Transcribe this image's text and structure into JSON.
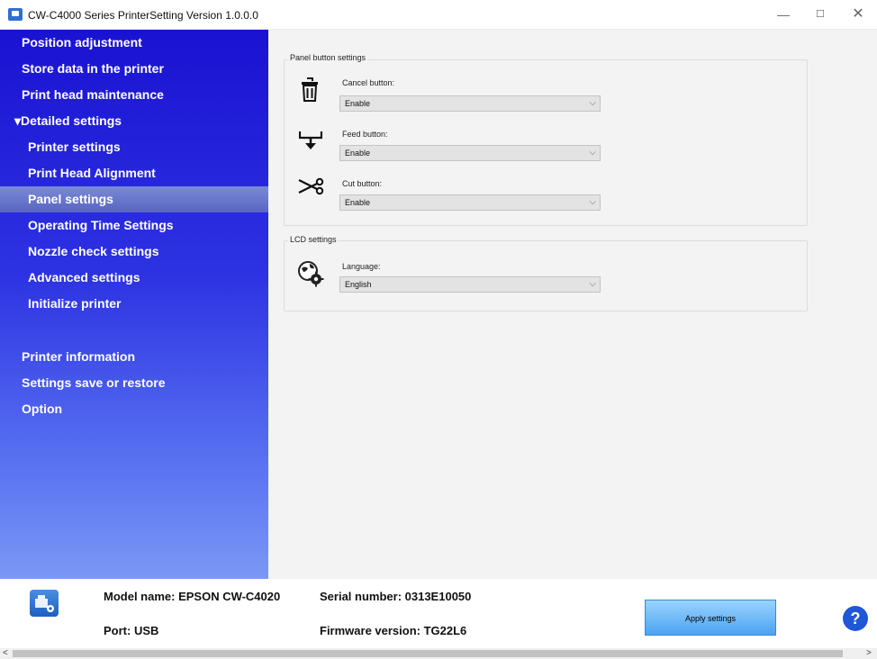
{
  "window": {
    "title": "CW-C4000 Series PrinterSetting Version 1.0.0.0",
    "controls": [
      "minimize",
      "maximize",
      "close"
    ]
  },
  "sidebar": {
    "items": [
      {
        "label": "Position adjustment"
      },
      {
        "label": "Store data in the printer"
      },
      {
        "label": "Print head maintenance"
      },
      {
        "label": "▾Detailed settings"
      },
      {
        "label": "Printer settings"
      },
      {
        "label": "Print Head Alignment"
      },
      {
        "label": "Panel settings",
        "active": true
      },
      {
        "label": "Operating Time Settings"
      },
      {
        "label": "Nozzle check settings"
      },
      {
        "label": "Advanced settings"
      },
      {
        "label": "Initialize printer"
      },
      {
        "label": "Printer information"
      },
      {
        "label": "Settings save or restore"
      },
      {
        "label": "Option"
      }
    ]
  },
  "panel_settings": {
    "group_label": "Panel button settings",
    "cancel": {
      "label": "Cancel button:",
      "value": "Enable",
      "icon": "trash-icon"
    },
    "feed": {
      "label": "Feed button:",
      "value": "Enable",
      "icon": "feed-arrow-icon"
    },
    "cut": {
      "label": "Cut button:",
      "value": "Enable",
      "icon": "scissors-icon"
    }
  },
  "lcd_settings": {
    "group_label": "LCD settings",
    "language": {
      "label": "Language:",
      "value": "English",
      "icon": "globe-gear-icon"
    }
  },
  "footer": {
    "model_name": "Model name: EPSON CW-C4020",
    "port": "Port: USB",
    "serial_number": "Serial number: 0313E10050",
    "firmware": "Firmware version: TG22L6",
    "apply_label": "Apply settings",
    "help_symbol": "?"
  },
  "colors": {
    "sidebar_top": "#1a12d2",
    "sidebar_bottom": "#7b98f5",
    "active_item": "#6e7acf",
    "apply_button": "#6ab8f8",
    "help_button": "#1f57d6"
  }
}
